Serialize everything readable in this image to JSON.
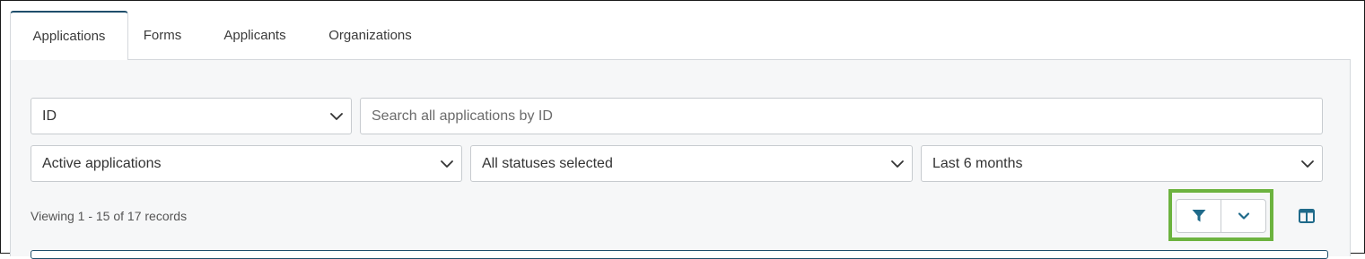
{
  "tabs": [
    {
      "label": "Applications",
      "active": true
    },
    {
      "label": "Forms",
      "active": false
    },
    {
      "label": "Applicants",
      "active": false
    },
    {
      "label": "Organizations",
      "active": false
    }
  ],
  "filters": {
    "search_field_select": "ID",
    "search_input_placeholder": "Search all applications by ID",
    "application_scope_select": "Active applications",
    "status_select": "All statuses selected",
    "date_range_select": "Last 6 months"
  },
  "results": {
    "records_text": "Viewing 1 - 15 of 17 records"
  },
  "toolbar": {
    "filter_icon": "filter-icon",
    "expand_icon": "chevron-down-icon",
    "columns_icon": "columns-icon"
  },
  "colors": {
    "accent": "#1f6a8a",
    "highlight": "#6cb33f",
    "active_tab_border": "#1f4e6b"
  }
}
